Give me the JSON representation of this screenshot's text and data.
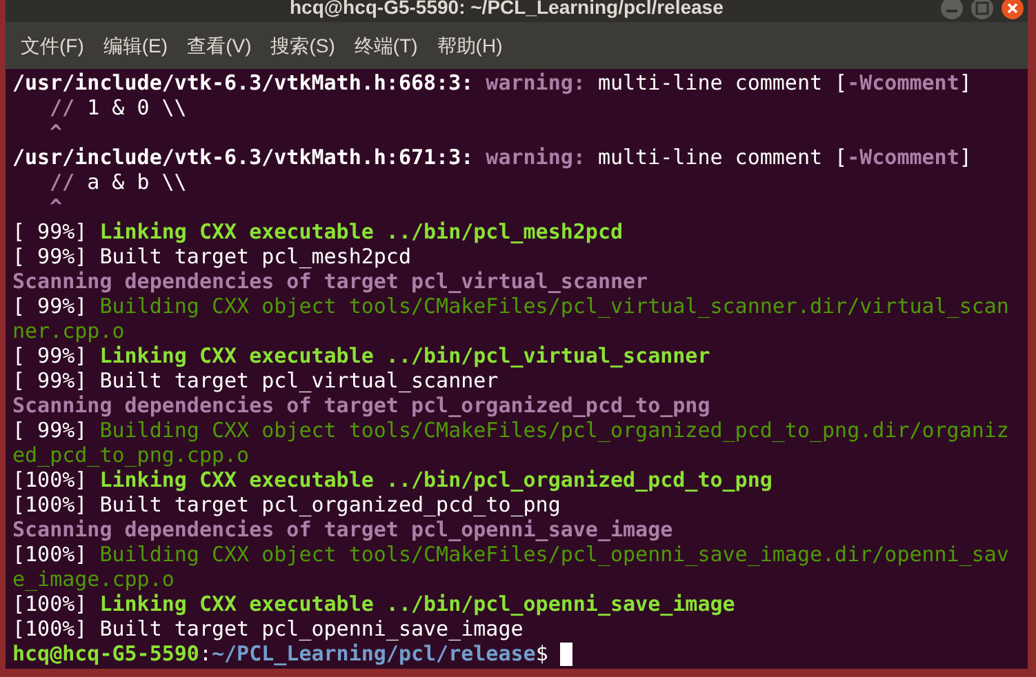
{
  "window": {
    "title": "hcq@hcq-G5-5590: ~/PCL_Learning/pcl/release"
  },
  "menu": [
    "文件(F)",
    "编辑(E)",
    "查看(V)",
    "搜索(S)",
    "终端(T)",
    "帮助(H)"
  ],
  "terminal_lines": [
    {
      "segments": [
        {
          "kind": "path",
          "text": "/usr/include/vtk-6.3/vtkMath.h:668:3: "
        },
        {
          "kind": "warning",
          "text": "warning: "
        },
        {
          "kind": "plain",
          "text": "multi-line comment ["
        },
        {
          "kind": "warning",
          "text": "-Wcomment"
        },
        {
          "kind": "plain",
          "text": "]"
        }
      ]
    },
    {
      "segments": [
        {
          "kind": "caret",
          "text": "//"
        },
        {
          "kind": "plain",
          "text": " 1 & 0 \\\\"
        }
      ]
    },
    {
      "segments": [
        {
          "kind": "caret",
          "text": "^"
        }
      ]
    },
    {
      "segments": [
        {
          "kind": "path",
          "text": "/usr/include/vtk-6.3/vtkMath.h:671:3: "
        },
        {
          "kind": "warning",
          "text": "warning: "
        },
        {
          "kind": "plain",
          "text": "multi-line comment ["
        },
        {
          "kind": "warning",
          "text": "-Wcomment"
        },
        {
          "kind": "plain",
          "text": "]"
        }
      ]
    },
    {
      "segments": [
        {
          "kind": "caret",
          "text": "//"
        },
        {
          "kind": "plain",
          "text": " a & b \\\\"
        }
      ]
    },
    {
      "segments": [
        {
          "kind": "caret",
          "text": "^"
        }
      ]
    },
    {
      "segments": [
        {
          "kind": "plain",
          "text": "[ 99%] "
        },
        {
          "kind": "linking",
          "text": "Linking CXX executable ../bin/pcl_mesh2pcd"
        }
      ]
    },
    {
      "segments": [
        {
          "kind": "plain",
          "text": "[ 99%] Built target pcl_mesh2pcd"
        }
      ]
    },
    {
      "segments": [
        {
          "kind": "scanning",
          "text": "Scanning dependencies of target pcl_virtual_scanner"
        }
      ]
    },
    {
      "segments": [
        {
          "kind": "plain",
          "text": "[ 99%] "
        },
        {
          "kind": "building",
          "text": "Building CXX object tools/CMakeFiles/pcl_virtual_scanner.dir/virtual_scan"
        }
      ]
    },
    {
      "segments": [
        {
          "kind": "building",
          "text": "ner.cpp.o"
        }
      ]
    },
    {
      "segments": [
        {
          "kind": "plain",
          "text": "[ 99%] "
        },
        {
          "kind": "linking",
          "text": "Linking CXX executable ../bin/pcl_virtual_scanner"
        }
      ]
    },
    {
      "segments": [
        {
          "kind": "plain",
          "text": "[ 99%] Built target pcl_virtual_scanner"
        }
      ]
    },
    {
      "segments": [
        {
          "kind": "scanning",
          "text": "Scanning dependencies of target pcl_organized_pcd_to_png"
        }
      ]
    },
    {
      "segments": [
        {
          "kind": "plain",
          "text": "[ 99%] "
        },
        {
          "kind": "building",
          "text": "Building CXX object tools/CMakeFiles/pcl_organized_pcd_to_png.dir/organiz"
        }
      ]
    },
    {
      "segments": [
        {
          "kind": "building",
          "text": "ed_pcd_to_png.cpp.o"
        }
      ]
    },
    {
      "segments": [
        {
          "kind": "plain",
          "text": "[100%] "
        },
        {
          "kind": "linking",
          "text": "Linking CXX executable ../bin/pcl_organized_pcd_to_png"
        }
      ]
    },
    {
      "segments": [
        {
          "kind": "plain",
          "text": "[100%] Built target pcl_organized_pcd_to_png"
        }
      ]
    },
    {
      "segments": [
        {
          "kind": "scanning",
          "text": "Scanning dependencies of target pcl_openni_save_image"
        }
      ]
    },
    {
      "segments": [
        {
          "kind": "plain",
          "text": "[100%] "
        },
        {
          "kind": "building",
          "text": "Building CXX object tools/CMakeFiles/pcl_openni_save_image.dir/openni_sav"
        }
      ]
    },
    {
      "segments": [
        {
          "kind": "building",
          "text": "e_image.cpp.o"
        }
      ]
    },
    {
      "segments": [
        {
          "kind": "plain",
          "text": "[100%] "
        },
        {
          "kind": "linking",
          "text": "Linking CXX executable ../bin/pcl_openni_save_image"
        }
      ]
    },
    {
      "segments": [
        {
          "kind": "plain",
          "text": "[100%] Built target pcl_openni_save_image"
        }
      ]
    }
  ],
  "prompt": {
    "user": "hcq@hcq-G5-5590",
    "separator": ":",
    "path": "~/PCL_Learning/pcl/release",
    "symbol": "$ "
  }
}
